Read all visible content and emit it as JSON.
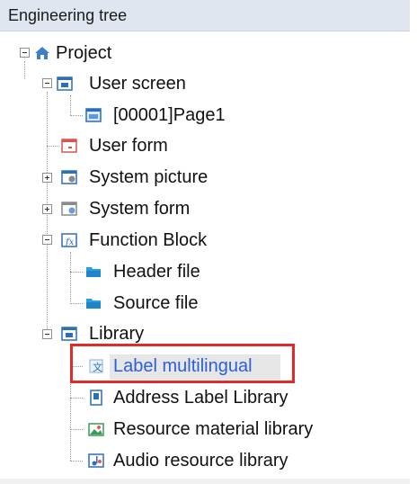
{
  "panel": {
    "title": "Engineering tree"
  },
  "tree": {
    "project": "Project",
    "user_screen": "User screen",
    "page1": "[00001]Page1",
    "user_form": "User form",
    "system_picture": "System picture",
    "system_form": "System form",
    "function_block": "Function Block",
    "header_file": "Header file",
    "source_file": "Source file",
    "library": "Library",
    "label_multilingual": "Label multilingual",
    "address_label_library": "Address Label Library",
    "resource_material_library": "Resource material library",
    "audio_resource_library": "Audio resource library"
  },
  "colors": {
    "highlight_border": "#e02b2b",
    "selected_text": "#2b5fd9",
    "header_bg": "#dfe6ef"
  },
  "selected_item": "Label multilingual"
}
